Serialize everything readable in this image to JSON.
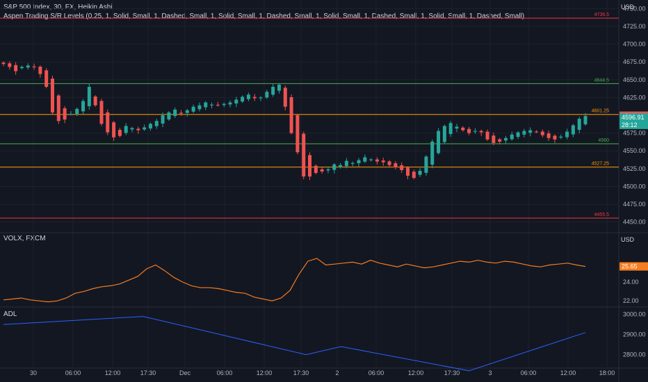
{
  "header": {
    "symbol": "S&P 500 Index, 30, FX, Heikin Ashi",
    "indicator": "Aspen Trading S/R Levels (0.25, 1, Solid, Small, 1, Dashed, Small, 1, Solid, Small, 1, Dashed, Small, 1, Solid, Small, 1, Dashed, Small, 1, Solid, Small, 1, Dashed, Small)",
    "volx_label": "VOLX, FXCM",
    "adl_label": "ADL",
    "currency": "USD"
  },
  "colors": {
    "background": "#131722",
    "grid": "#1e222d",
    "bull": "#26a69a",
    "bear": "#ef5350",
    "axis_text": "#b2b5be",
    "volx_line": "#f57c1f",
    "adl_line": "#2962ff"
  },
  "chart_data": [
    {
      "type": "candlestick",
      "title": "S&P 500 Index, 30, FX, Heikin Ashi",
      "x_ticks": [
        "30",
        "06:00",
        "12:00",
        "17:30",
        "Dec",
        "06:00",
        "12:00",
        "17:30",
        "2",
        "06:00",
        "12:00",
        "17:30",
        "3",
        "06:00",
        "12:00",
        "18:00"
      ],
      "y_ticks": [
        4450,
        4475,
        4500,
        4525,
        4550,
        4575,
        4600,
        4625,
        4650,
        4675,
        4700,
        4725,
        4750
      ],
      "ylim": [
        4437,
        4762
      ],
      "levels": [
        {
          "label": "4736.5",
          "value": 4736.5,
          "color": "#f23645"
        },
        {
          "label": "4644.5",
          "value": 4644.5,
          "color": "#4caf50"
        },
        {
          "label": "4601.25",
          "value": 4601.25,
          "color": "#ff9800"
        },
        {
          "label": "4560",
          "value": 4560,
          "color": "#4caf50"
        },
        {
          "label": "4527.25",
          "value": 4527.25,
          "color": "#ff9800"
        },
        {
          "label": "4455.5",
          "value": 4455.5,
          "color": "#f23645"
        }
      ],
      "price_tags": [
        {
          "label": "4599.43",
          "value": 4599.43,
          "color": "#ef5350"
        },
        {
          "label": "4596.91",
          "value": 4596.91,
          "color": "#26a69a"
        },
        {
          "label": "28:12",
          "value": 4586.5,
          "color": "#26a69a"
        }
      ],
      "close_path": [
        4672,
        4668,
        4662,
        4668,
        4670,
        4668,
        4658,
        4640,
        4604,
        4592,
        4594,
        4602,
        4609,
        4620,
        4640,
        4614,
        4588,
        4576,
        4569,
        4571,
        4585,
        4582,
        4579,
        4583,
        4588,
        4592,
        4600,
        4604,
        4608,
        4603,
        4607,
        4612,
        4614,
        4618,
        4615,
        4614,
        4616,
        4618,
        4622,
        4626,
        4629,
        4624,
        4625,
        4633,
        4640,
        4643,
        4612,
        4575,
        4548,
        4514,
        4514,
        4519,
        4521,
        4524,
        4531,
        4530,
        4536,
        4533,
        4537,
        4541,
        4538,
        4535,
        4534,
        4530,
        4527,
        4523,
        4515,
        4512,
        4522,
        4542,
        4563,
        4578,
        4585,
        4589,
        4584,
        4579,
        4575,
        4578,
        4576,
        4566,
        4561,
        4563,
        4568,
        4573,
        4576,
        4578,
        4579,
        4577,
        4572,
        4568,
        4566,
        4570,
        4577,
        4586,
        4595,
        4599
      ]
    },
    {
      "type": "line",
      "title": "VOLX, FXCM",
      "y_ticks": [
        22.0,
        24.0,
        26.0
      ],
      "y_tick_labels": [
        "22.00",
        "24.00",
        "25.65"
      ],
      "ylim": [
        21.5,
        29
      ],
      "last_value_label": "25.65",
      "last_value": 25.65,
      "values": [
        22.1,
        22.2,
        22.3,
        22.1,
        22.0,
        21.9,
        22.0,
        22.3,
        22.8,
        23.0,
        23.3,
        23.5,
        23.6,
        23.8,
        24.2,
        24.6,
        25.4,
        25.8,
        25.2,
        24.5,
        24.0,
        23.6,
        23.4,
        23.4,
        23.3,
        23.1,
        22.9,
        22.8,
        22.4,
        22.2,
        22.0,
        22.3,
        23.1,
        24.8,
        26.2,
        26.5,
        25.8,
        25.9,
        26.0,
        26.1,
        25.9,
        26.3,
        26.0,
        25.8,
        25.6,
        25.9,
        25.7,
        25.5,
        25.6,
        25.8,
        26.0,
        26.2,
        26.1,
        26.3,
        26.1,
        26.0,
        26.2,
        26.1,
        25.9,
        25.7,
        25.6,
        25.8,
        25.9,
        26.0,
        25.8,
        25.65
      ],
      "series_color": "#f57c1f"
    },
    {
      "type": "line",
      "title": "ADL",
      "y_ticks": [
        2800,
        2900,
        3000
      ],
      "y_tick_labels": [
        "2800.00",
        "2900.00",
        "3000.00"
      ],
      "ylim": [
        2740,
        3030
      ],
      "points": [
        [
          0,
          2950
        ],
        [
          24,
          2990
        ],
        [
          52,
          2800
        ],
        [
          58,
          2840
        ],
        [
          80,
          2720
        ],
        [
          100,
          2910
        ]
      ],
      "series_color": "#2962ff"
    }
  ]
}
